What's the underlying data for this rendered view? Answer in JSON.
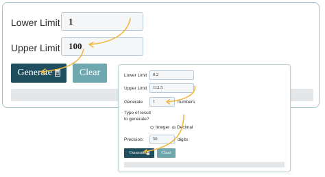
{
  "back_form": {
    "lower_limit_label": "Lower Limit",
    "lower_limit_value": "1",
    "upper_limit_label": "Upper Limit",
    "upper_limit_value": "100",
    "generate_label": "Generate",
    "clear_label": "Clear"
  },
  "front_form": {
    "lower_limit_label": "Lower Limit",
    "lower_limit_value": "0.2",
    "upper_limit_label": "Upper Limit",
    "upper_limit_value": "112.5",
    "generate_label": "Generate",
    "generate_value": "1",
    "numbers_suffix": "numbers",
    "result_type_question_line1": "Type of result",
    "result_type_question_line2": "to generate?",
    "option_integer": "Integer",
    "option_decimal": "Decimal",
    "selected_option": "Decimal",
    "precision_label": "Precision:",
    "precision_value": "50",
    "precision_suffix": "digits",
    "generate_button_label": "Generate",
    "clear_button_label": "Clear"
  },
  "colors": {
    "primary": "#1f4e5f",
    "secondary": "#6ea7ad",
    "annotation_arrow": "#f0b840",
    "card_border": "#9dc4c8"
  },
  "icons": {
    "generate_button_icon": "calculator-icon",
    "annotation": "curved-arrow-icon"
  }
}
